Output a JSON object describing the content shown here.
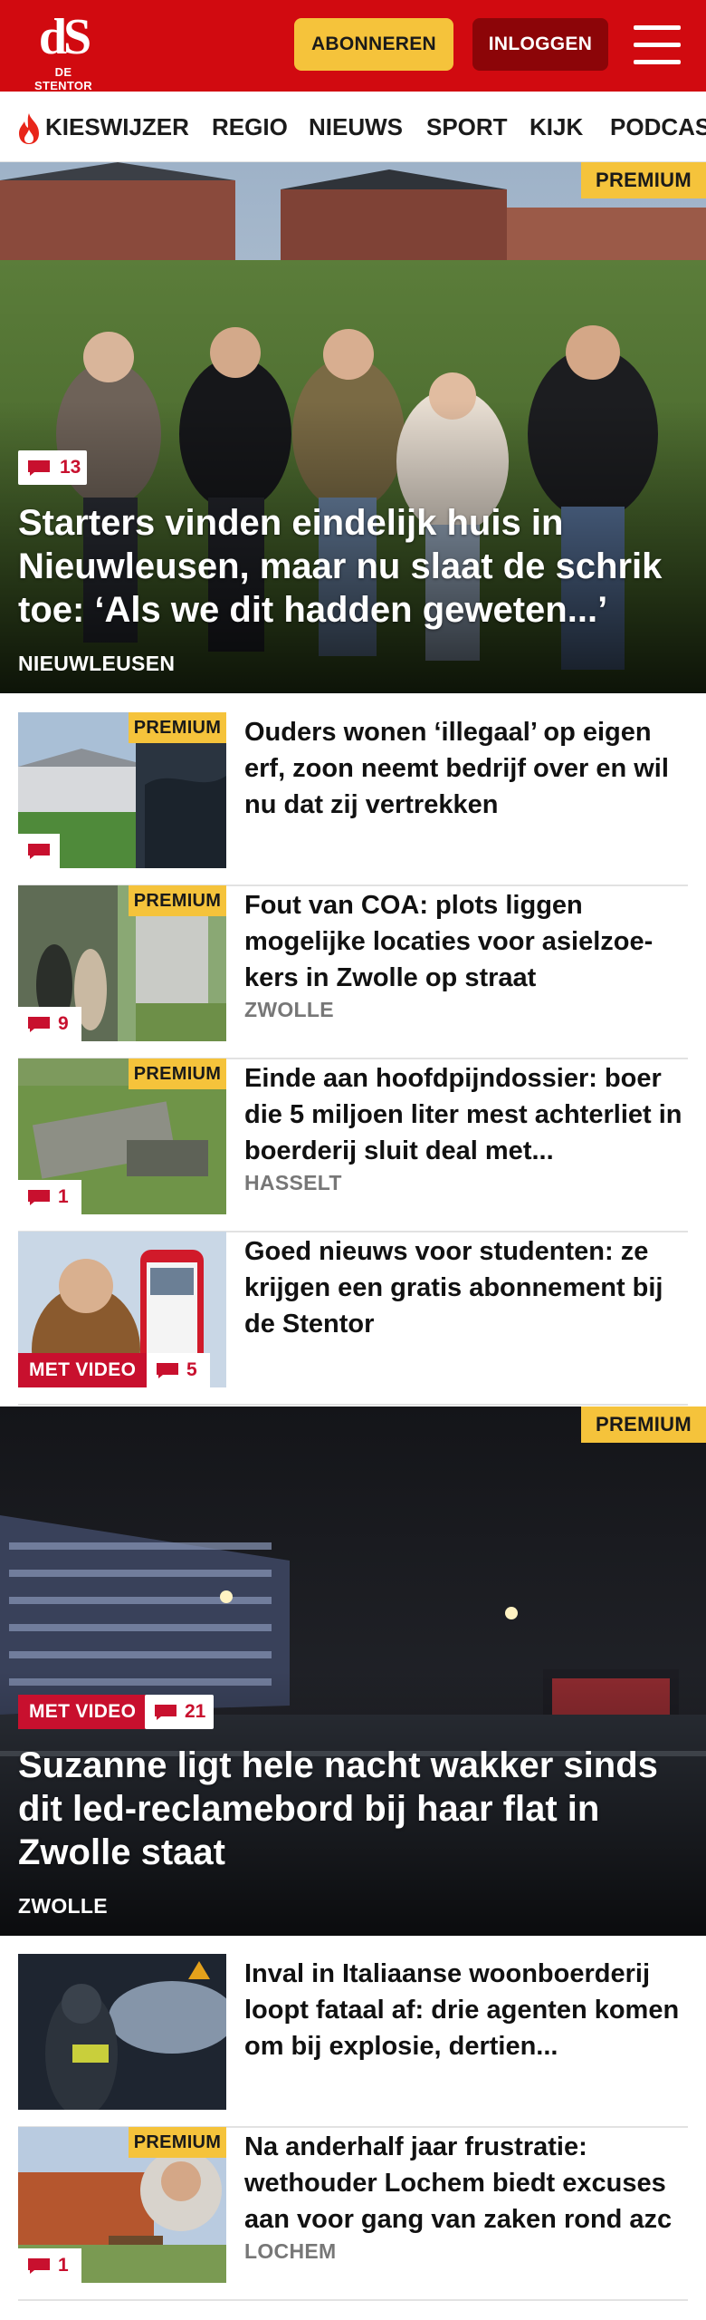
{
  "header": {
    "logo_mark": "dS",
    "logo_text": "DE STENTOR",
    "subscribe_label": "ABONNEREN",
    "login_label": "INLOGGEN",
    "brand_color": "#d10a10",
    "accent_color": "#f5c33b"
  },
  "nav": {
    "items": [
      {
        "label": "KIESWIJZER",
        "icon": "flame-icon"
      },
      {
        "label": "REGIO"
      },
      {
        "label": "NIEUWS"
      },
      {
        "label": "SPORT"
      },
      {
        "label": "KIJK"
      },
      {
        "label": "PODCAS"
      }
    ]
  },
  "articles": {
    "hero1": {
      "premium": "PREMIUM",
      "comments": "13",
      "title": "Starters vinden eindelijk huis in Nieuwleusen, maar nu slaat de schrik toe: ‘Als we dit hadden geweten...’",
      "location": "NIEUWLEUSEN"
    },
    "list1": [
      {
        "premium": "PREMIUM",
        "comments": "",
        "title": "Ouders wonen ‘illegaal’ op eigen erf, zoon neemt bedrijf over en wil nu dat zij vertrekken",
        "location": ""
      },
      {
        "premium": "PREMIUM",
        "comments": "9",
        "title": "Fout van COA: plots liggen mogelijke locaties voor asielzoe­kers in Zwolle op straat",
        "location": "ZWOLLE"
      },
      {
        "premium": "PREMIUM",
        "comments": "1",
        "title": "Einde aan hoofdpijndossier: boer die 5 miljoen liter mest achterliet in boerderij sluit deal met...",
        "location": "HASSELT"
      },
      {
        "video": "MET VIDEO",
        "comments": "5",
        "title": "Goed nieuws voor studenten: ze krijgen een gratis abonnement bij de Stentor",
        "location": ""
      }
    ],
    "hero2": {
      "premium": "PREMIUM",
      "video": "MET VIDEO",
      "comments": "21",
      "title": "Suzanne ligt hele nacht wakker sinds dit led-reclamebord bij haar flat in Zwolle staat",
      "location": "ZWOLLE"
    },
    "list2": [
      {
        "title": "Inval in Italiaanse woonboerderij loopt fataal af: drie agenten komen om bij explosie, dertien...",
        "location": ""
      },
      {
        "premium": "PREMIUM",
        "comments": "1",
        "title": "Na anderhalf jaar frustratie: wethouder Lochem biedt excuses aan voor gang van zaken rond azc",
        "location": "LOCHEM"
      }
    ]
  }
}
